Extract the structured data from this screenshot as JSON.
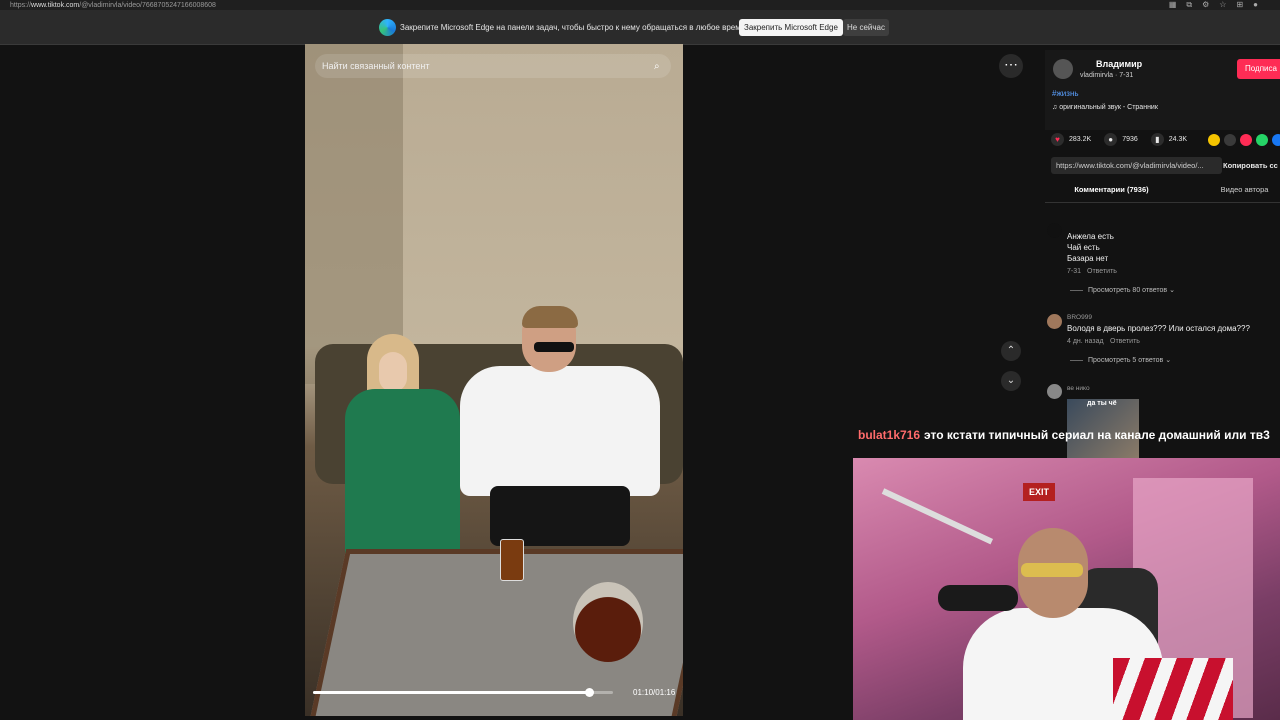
{
  "browser": {
    "url_prefix": "https://",
    "url_domain": "www.tiktok.com",
    "url_path": "/@vladimirvla/video/7668705247166008608",
    "tool_icons": [
      "apps-icon",
      "extensions-icon",
      "settings-icon",
      "favorites-icon",
      "collections-icon",
      "profile-icon"
    ]
  },
  "edge_bar": {
    "message": "Закрепите Microsoft Edge на панели задач, чтобы быстро к нему обращаться в любое время",
    "pin_label": "Закрепить Microsoft Edge",
    "dismiss_label": "Не сейчас"
  },
  "video": {
    "search_placeholder": "Найти связанный контент",
    "time": "01:10/01:16",
    "progress": 0.92
  },
  "author": {
    "name": "Владимир",
    "meta": "vladimirvla · 7-31",
    "follow_label": "Подписа",
    "hashtag": "#жизнь",
    "sound": "♫  оригинальный звук - Странник"
  },
  "stats": {
    "likes": "283.2K",
    "comments": "7936",
    "saves": "24.3K"
  },
  "share_colors": [
    "#f5c400",
    "#3a3a3a",
    "#fe2c55",
    "#25d366",
    "#1877f2"
  ],
  "link": {
    "url": "https://www.tiktok.com/@vladimirvla/video/...",
    "copy_label": "Копировать сс"
  },
  "tabs": {
    "comments": "Комментарии (7936)",
    "author_videos": "Видео автора"
  },
  "comments": [
    {
      "user": "",
      "lines": [
        "Анжела есть",
        "Чай есть",
        "Базара нет"
      ],
      "date": "7-31",
      "reply_label": "Ответить",
      "more_replies": "Просмотреть 80 ответов ⌄"
    },
    {
      "user": "BRO999",
      "lines": [
        "Володя в дверь пролез??? Или остался дома???"
      ],
      "date": "4 дн. назад",
      "reply_label": "Ответить",
      "more_replies": "Просмотреть 5 ответов ⌄"
    },
    {
      "user": "ве нико",
      "gif_label": "да ты чё"
    }
  ],
  "stream_chat": {
    "user": "bulat1k716",
    "message": "это кстати типичный сериал на канале домашний или тв3"
  },
  "webcam": {
    "sign_text": "EXIT"
  }
}
